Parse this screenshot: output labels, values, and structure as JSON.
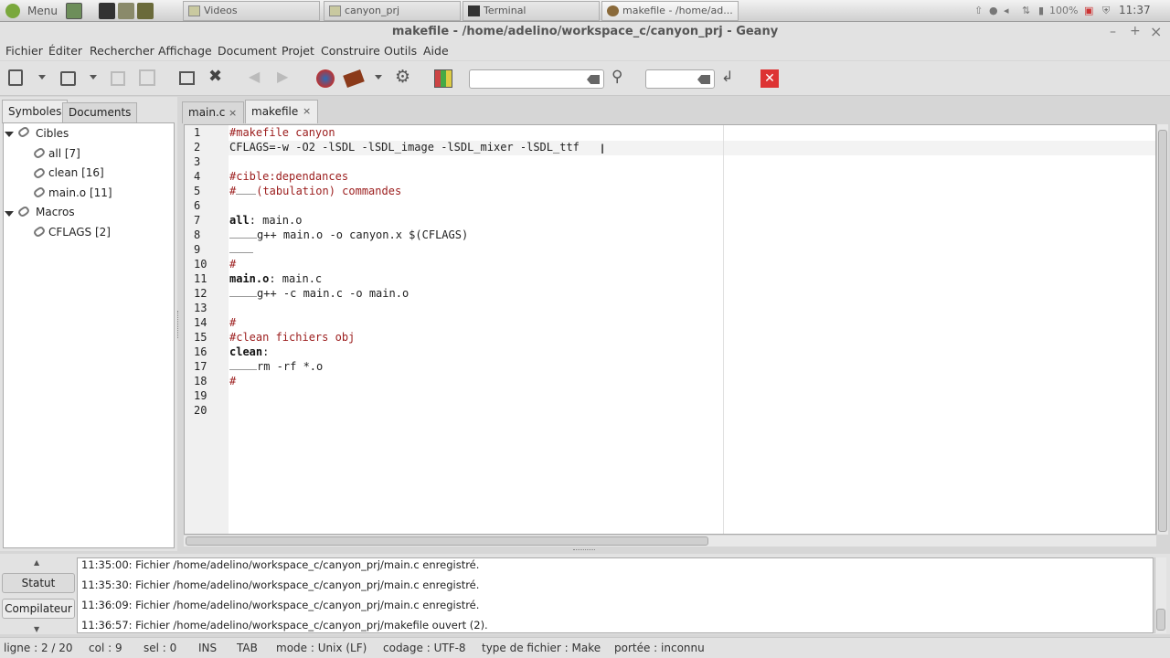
{
  "taskbar": {
    "menu_label": "Menu",
    "tasks": [
      {
        "label": "Videos"
      },
      {
        "label": "canyon_prj"
      },
      {
        "label": "Terminal"
      },
      {
        "label": "makefile - /home/ad..."
      }
    ],
    "battery": "100%",
    "clock": "11:37"
  },
  "window": {
    "title": "makefile - /home/adelino/workspace_c/canyon_prj - Geany",
    "minimize": "–",
    "maximize": "+",
    "close": "×"
  },
  "menubar": [
    "Fichier",
    "Éditer",
    "Rechercher",
    "Affichage",
    "Document",
    "Projet",
    "Construire",
    "Outils",
    "Aide"
  ],
  "toolbar": {
    "search_value": "",
    "goto_value": ""
  },
  "sidebar": {
    "tabs": [
      "Symboles",
      "Documents"
    ],
    "tree": {
      "group1": "Cibles",
      "group1_items": [
        "all [7]",
        "clean [16]",
        "main.o [11]"
      ],
      "group2": "Macros",
      "group2_items": [
        "CFLAGS [2]"
      ]
    }
  },
  "editor": {
    "tabs": [
      {
        "label": "main.c",
        "close": "×"
      },
      {
        "label": "makefile",
        "close": "×"
      }
    ],
    "line_numbers": [
      "1",
      "2",
      "3",
      "4",
      "5",
      "6",
      "7",
      "8",
      "9",
      "10",
      "11",
      "12",
      "13",
      "14",
      "15",
      "16",
      "17",
      "18",
      "19",
      "20"
    ],
    "lines": {
      "l1": "#makefile canyon",
      "l2": "CFLAGS=-w -O2 -lSDL -lSDL_image -lSDL_mixer -lSDL_ttf",
      "l4": "#cible:dependances",
      "l5_hash": "#",
      "l5_rest": "(tabulation) commandes",
      "l7_kw": "all",
      "l7_rest": ": main.o",
      "l8": "g++ main.o -o canyon.x $(CFLAGS)",
      "l10": "#",
      "l11_kw": "main.o",
      "l11_rest": ": main.c",
      "l12": "g++ -c main.c -o main.o",
      "l14": "#",
      "l15": "#clean fichiers obj",
      "l16_kw": "clean",
      "l16_rest": ":",
      "l17": "rm -rf *.o",
      "l18": "#"
    }
  },
  "messages": {
    "side_tabs": [
      "Statut",
      "Compilateur"
    ],
    "up_arrow": "▲",
    "down_arrow": "▼",
    "lines": [
      "11:35:00: Fichier /home/adelino/workspace_c/canyon_prj/main.c enregistré.",
      "11:35:30: Fichier /home/adelino/workspace_c/canyon_prj/main.c enregistré.",
      "11:36:09: Fichier /home/adelino/workspace_c/canyon_prj/main.c enregistré.",
      "11:36:57: Fichier /home/adelino/workspace_c/canyon_prj/makefile ouvert (2)."
    ]
  },
  "statusbar": {
    "line": "ligne : 2 / 20",
    "col": "col : 9",
    "sel": "sel : 0",
    "ins": "INS",
    "tab": "TAB",
    "mode": "mode : Unix (LF)",
    "encoding": "codage : UTF-8",
    "filetype": "type de fichier : Make",
    "scope": "portée : inconnu"
  }
}
